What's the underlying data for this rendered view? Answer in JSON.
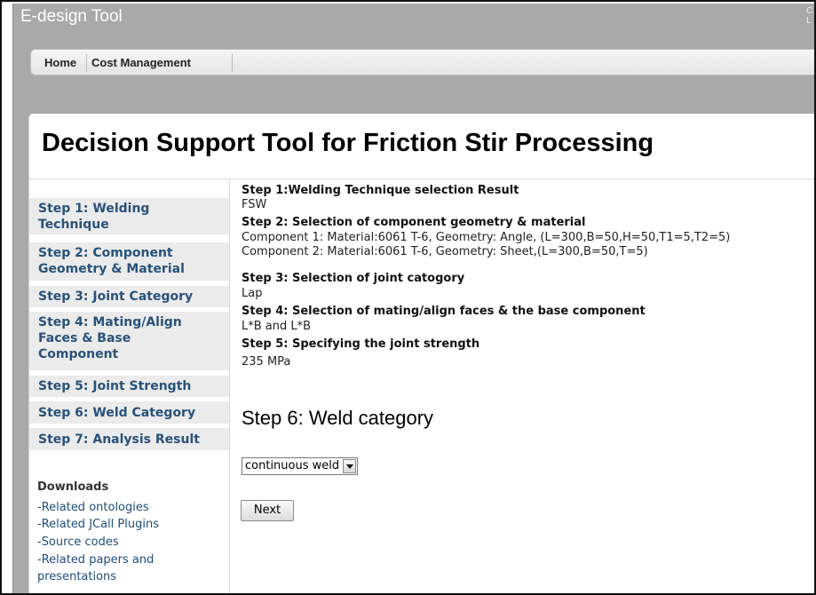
{
  "app": {
    "title": "E-design Tool",
    "corner_line1": "C",
    "corner_line2": "L"
  },
  "nav": {
    "items": [
      "Home",
      "Cost Management"
    ]
  },
  "page": {
    "title": "Decision Support Tool for Friction Stir Processing"
  },
  "sidebar": {
    "items": [
      {
        "label_line1": "Step 1: Welding",
        "label_line2": "Technique"
      },
      {
        "label_line1": "Step 2: Component",
        "label_line2": "Geometry & Material"
      },
      {
        "label_line1": "Step 3: Joint Category"
      },
      {
        "label_line1": "Step 4: Mating/Align",
        "label_line2": "Faces & Base",
        "label_line3": "Component"
      },
      {
        "label_line1": "Step 5: Joint Strength"
      },
      {
        "label_line1": "Step 6: Weld Category"
      },
      {
        "label_line1": "Step 7: Analysis Result"
      }
    ],
    "downloads": {
      "title": "Downloads",
      "links": [
        "-Related ontologies",
        "-Related JCall Plugins",
        "-Source codes",
        "-Related papers and",
        "presentations"
      ]
    }
  },
  "summary": {
    "step1_heading": "Step 1:Welding Technique selection Result",
    "step1_value": "FSW",
    "step2_heading": "Step 2: Selection of component geometry & material",
    "step2_line1": "Component 1: Material:6061 T-6, Geometry: Angle, (L=300,B=50,H=50,T1=5,T2=5)",
    "step2_line2": "Component 2: Material:6061 T-6, Geometry: Sheet,(L=300,B=50,T=5)",
    "step3_heading": "Step 3: Selection of joint catogory",
    "step3_value": "Lap",
    "step4_heading": "Step 4: Selection of mating/align faces & the base component",
    "step4_value": "L*B and L*B",
    "step5_heading": "Step 5: Specifying the joint strength",
    "step5_value": "235 MPa"
  },
  "step6": {
    "heading": "Step 6: Weld category",
    "select_value": "continuous weld",
    "next_label": "Next"
  },
  "colors": {
    "header_bg": "#a9a9a9",
    "sidebar_item_bg": "#ebebeb",
    "sidebar_text": "#28527a",
    "link": "#1f4d7a"
  },
  "icons": {
    "select_arrow": "chevron-down-icon"
  }
}
